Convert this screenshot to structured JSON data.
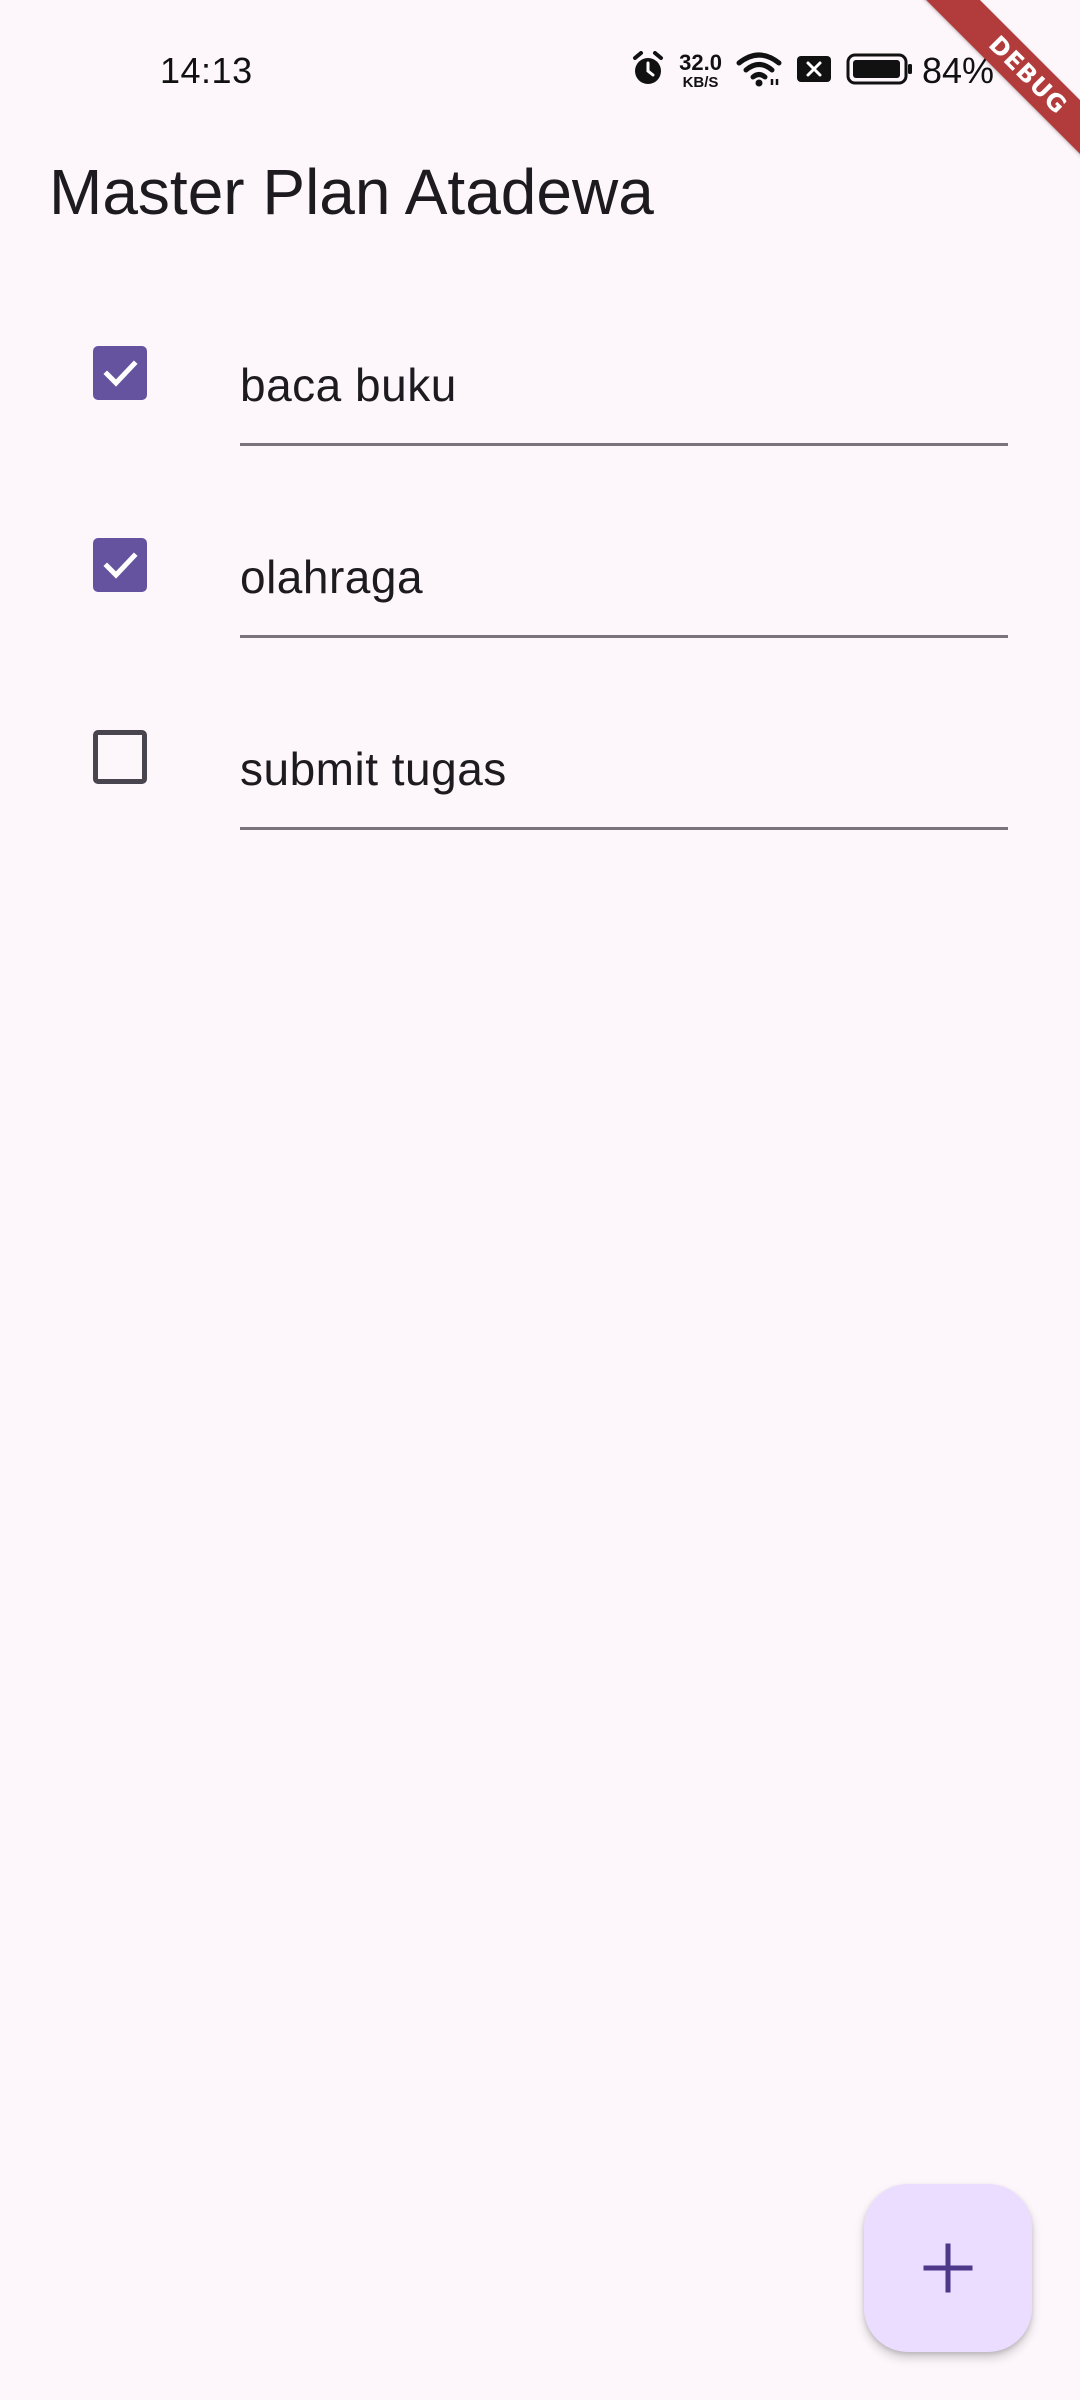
{
  "status_bar": {
    "time": "14:13",
    "net_speed_value": "32.0",
    "net_speed_unit": "KB/S",
    "battery_percent": "84%",
    "icons": [
      "alarm-icon",
      "wifi-icon",
      "sim-off-icon",
      "battery-icon"
    ]
  },
  "debug_banner": "DEBUG",
  "app_bar": {
    "title": "Master Plan Atadewa"
  },
  "tasks": [
    {
      "description": "baca buku",
      "complete": true
    },
    {
      "description": "olahraga",
      "complete": true
    },
    {
      "description": "submit tugas",
      "complete": false
    }
  ],
  "fab": {
    "icon": "add-icon"
  },
  "colors": {
    "background": "#fdf7fc",
    "checkbox_checked": "#65539f",
    "checkbox_border": "#49454f",
    "fab_background": "#eaddff",
    "fab_icon": "#4f378a",
    "debug_banner": "#b23c3c"
  }
}
